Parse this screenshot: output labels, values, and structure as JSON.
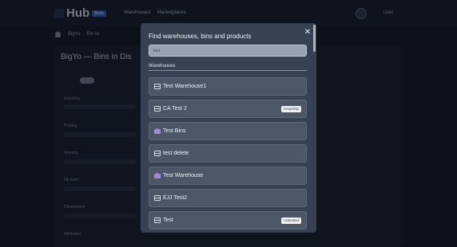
{
  "app": {
    "logo_text": "Hub",
    "logo_badge": "Beta",
    "nav": [
      "Warehouses",
      "Marketplaces"
    ],
    "user_name": "User"
  },
  "breadcrumb": [
    "BigYo",
    "Bin-In"
  ],
  "background_panel": {
    "title": "BigYo — Bins in Dis",
    "field_labels": [
      "Inventory",
      "Picking",
      "Velocity",
      "Fill Rate",
      "Dimensions",
      "Attributes"
    ]
  },
  "modal": {
    "title": "Find warehouses, bins and products",
    "search_value": "test",
    "search_placeholder": "",
    "close_label": "✕",
    "section_label": "Warehouses",
    "items": [
      {
        "label": "Test Warehouse1",
        "icon": "box-icon",
        "badge": ""
      },
      {
        "label": "CA Test 2",
        "icon": "box-icon",
        "badge": "DropShip"
      },
      {
        "label": "Test Bins",
        "icon": "warehouse-icon",
        "badge": ""
      },
      {
        "label": "test delete",
        "icon": "box-icon",
        "badge": ""
      },
      {
        "label": "Test Warehouse",
        "icon": "warehouse-icon",
        "badge": ""
      },
      {
        "label": "EJJ Test2",
        "icon": "box-icon",
        "badge": ""
      },
      {
        "label": "Test",
        "icon": "box-icon",
        "badge": "Unlocked"
      }
    ]
  },
  "colors": {
    "background": "#111623",
    "modal": "#374152",
    "item": "#4c5667",
    "warehouse_icon": "#a58ad9"
  }
}
